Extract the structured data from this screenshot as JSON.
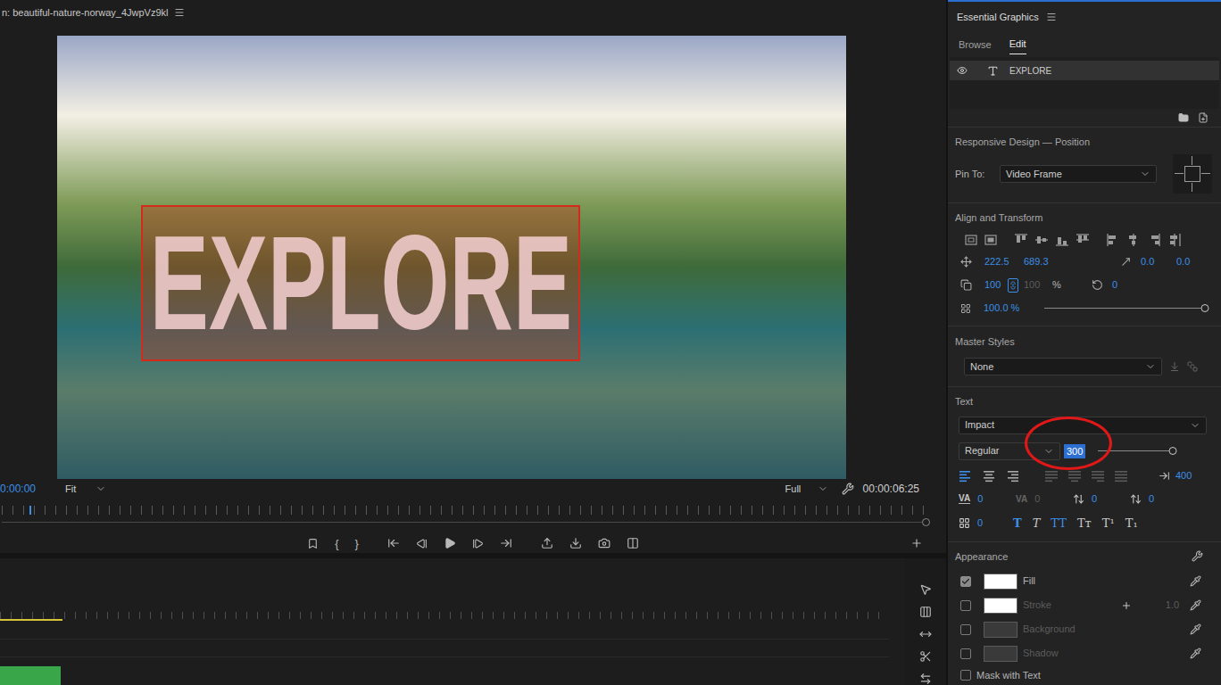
{
  "program_monitor": {
    "title": "n: beautiful-nature-norway_4JwpVz9kl",
    "timecode": "0:00:00",
    "zoom": "Fit",
    "resolution": "Full",
    "duration": "00:00:06:25",
    "playhead_level": 0.03,
    "mark_in": "{",
    "mark_out": "}"
  },
  "timeline": {
    "work_area_level": 0.07
  },
  "panel": {
    "title": "Essential Graphics",
    "tabs": [
      {
        "label": "Browse",
        "selected": false
      },
      {
        "label": "Edit",
        "selected": true
      }
    ],
    "layers": [
      {
        "name": "EXPLORE",
        "visible": true,
        "selected": true
      }
    ]
  },
  "responsive_design": {
    "title": "Responsive Design — Position",
    "pin_to_label": "Pin To:",
    "pin_to": "Video Frame"
  },
  "align_transform": {
    "title": "Align and Transform",
    "position_x": "222.5",
    "position_y": "689.3",
    "anchor_x": "0.0",
    "anchor_y": "0.0",
    "scale": "100",
    "scale_height": "100",
    "scale_height_disabled": true,
    "uniform_scale": true,
    "scale_unit": "%",
    "rotation": "0",
    "opacity": "100.0 %",
    "opacity_level": 1.0
  },
  "master_styles": {
    "title": "Master Styles",
    "value": "None"
  },
  "text": {
    "title": "Text",
    "font": "Impact",
    "style": "Regular",
    "size": "300",
    "size_selected": true,
    "size_level": 0.95,
    "annotated": true,
    "tab_width": "400",
    "alignments": [
      {
        "kind": "left",
        "selected": true,
        "disabled": false
      },
      {
        "kind": "center",
        "selected": false,
        "disabled": false
      },
      {
        "kind": "right",
        "selected": false,
        "disabled": false
      },
      {
        "kind": "justify-left",
        "selected": false,
        "disabled": true
      },
      {
        "kind": "justify-center",
        "selected": false,
        "disabled": true
      },
      {
        "kind": "justify-right",
        "selected": false,
        "disabled": true
      },
      {
        "kind": "justify-all",
        "selected": false,
        "disabled": true
      }
    ],
    "spacing": [
      {
        "kind": "kerning",
        "glyph": "VA",
        "value": "0",
        "disabled": false
      },
      {
        "kind": "tracking",
        "glyph": "VA",
        "value": "0",
        "disabled": true
      },
      {
        "kind": "leading",
        "glyph": "",
        "value": "0",
        "disabled": false
      },
      {
        "kind": "baseline",
        "glyph": "",
        "value": "0",
        "disabled": false
      }
    ],
    "tsume": "0",
    "styles": [
      {
        "label": "T",
        "kind": "bold",
        "selected": true
      },
      {
        "label": "T",
        "kind": "italic",
        "selected": false
      },
      {
        "label": "TT",
        "kind": "caps",
        "selected": true
      },
      {
        "label": "Tт",
        "kind": "small-caps",
        "selected": false
      },
      {
        "label": "T¹",
        "kind": "superscript",
        "selected": false
      },
      {
        "label": "T₁",
        "kind": "subscript",
        "selected": false
      }
    ]
  },
  "appearance": {
    "title": "Appearance",
    "items": [
      {
        "label": "Fill",
        "checked": true,
        "disabled": false,
        "color": "#ffffff",
        "kind": "fill",
        "width": ""
      },
      {
        "label": "Stroke",
        "checked": false,
        "disabled": true,
        "color": "#ffffff",
        "kind": "stroke",
        "width": "1.0"
      },
      {
        "label": "Background",
        "checked": false,
        "disabled": true,
        "color": "#3a3a3a",
        "kind": "plain",
        "width": ""
      },
      {
        "label": "Shadow",
        "checked": false,
        "disabled": true,
        "color": "#3a3a3a",
        "kind": "plain",
        "width": ""
      }
    ],
    "mask_with_text": {
      "label": "Mask with Text",
      "checked": false
    }
  }
}
